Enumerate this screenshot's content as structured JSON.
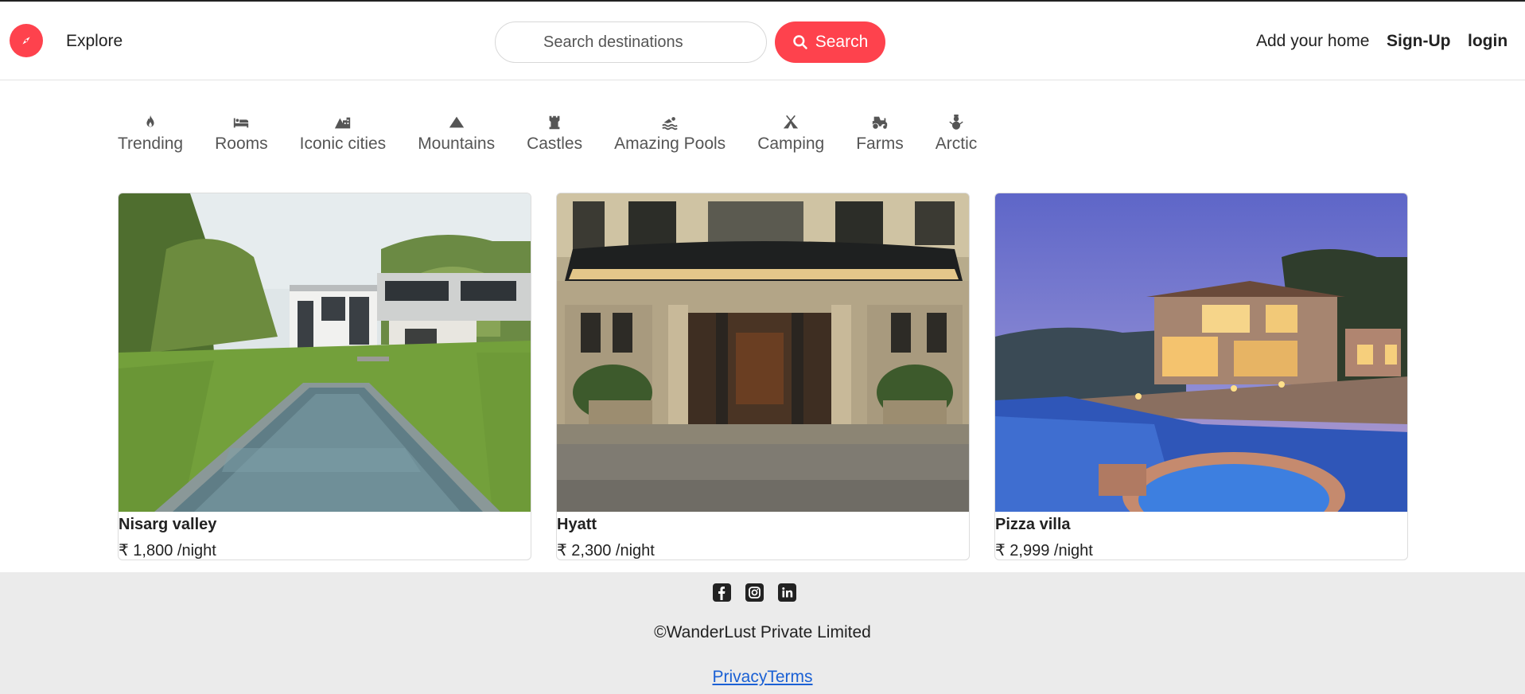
{
  "navbar": {
    "logo_icon": "compass-icon",
    "explore_label": "Explore",
    "search": {
      "placeholder": "Search destinations",
      "button_label": "Search",
      "button_icon": "search-icon"
    },
    "add_home_label": "Add your home",
    "signup_label": "Sign-Up",
    "login_label": "login",
    "accent_color": "#fe424d"
  },
  "filters": [
    {
      "icon": "fire-icon",
      "label": "Trending"
    },
    {
      "icon": "bed-icon",
      "label": "Rooms"
    },
    {
      "icon": "mountain-city-icon",
      "label": "Iconic cities"
    },
    {
      "icon": "mountain-icon",
      "label": "Mountains"
    },
    {
      "icon": "castle-icon",
      "label": "Castles"
    },
    {
      "icon": "person-swimming-icon",
      "label": "Amazing Pools"
    },
    {
      "icon": "campground-icon",
      "label": "Camping"
    },
    {
      "icon": "tractor-icon",
      "label": "Farms"
    },
    {
      "icon": "snowman-icon",
      "label": "Arctic"
    }
  ],
  "listings": [
    {
      "title": "Nisarg valley",
      "price": "₹ 1,800 /night"
    },
    {
      "title": "Hyatt",
      "price": "₹ 2,300 /night"
    },
    {
      "title": "Pizza villa",
      "price": "₹ 2,999 /night"
    }
  ],
  "footer": {
    "social_icons": [
      "facebook-icon",
      "instagram-icon",
      "linkedin-icon"
    ],
    "copyright": "©WanderLust Private Limited",
    "privacy_label": "Privacy",
    "terms_label": "Terms",
    "background": "#ebebeb"
  }
}
